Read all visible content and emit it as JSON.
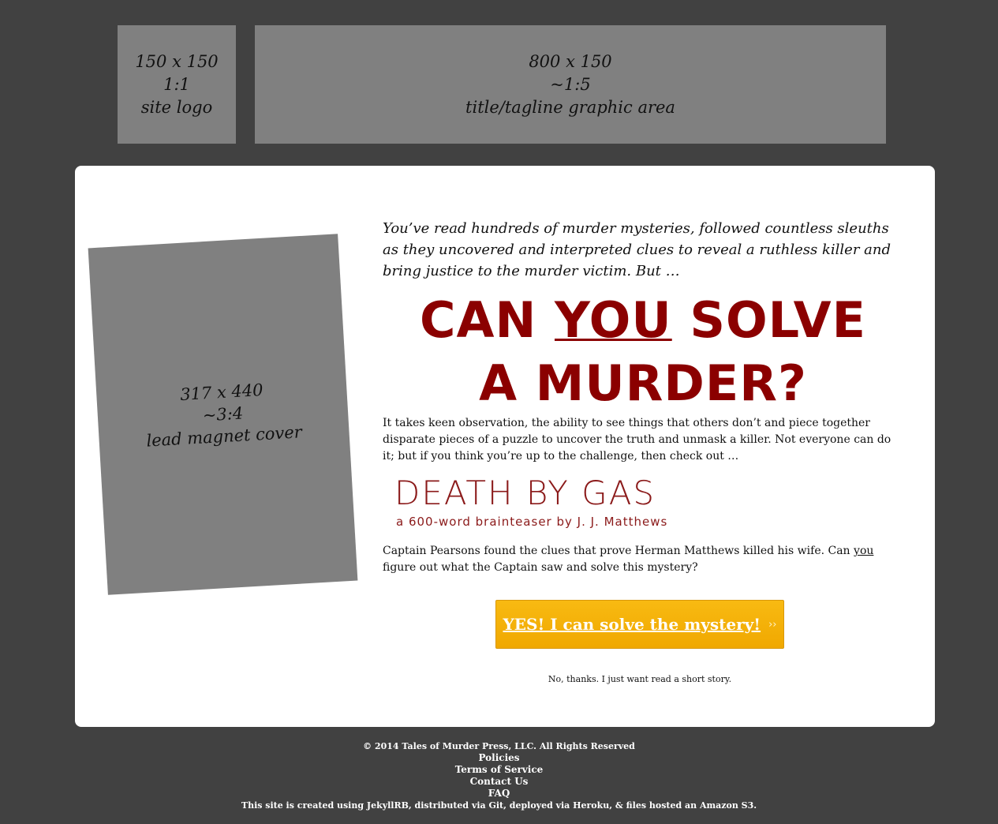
{
  "header": {
    "logo": {
      "size": "150 x 150",
      "ratio": "1:1",
      "label": "site logo"
    },
    "tagline": {
      "size": "800 x 150",
      "ratio": "~1:5",
      "label": "title/tagline graphic area"
    }
  },
  "main": {
    "cover": {
      "size": "317 x 440",
      "ratio": "~3:4",
      "label": "lead magnet cover"
    },
    "intro": "You’ve read hundreds of murder mysteries, followed countless sleuths as they uncovered and interpreted clues to reveal a ruthless killer and bring justice to the murder victim. But …",
    "headline": {
      "line1_start": "CAN ",
      "line1_you": "YOU",
      "line1_end": " SOLVE",
      "line2": "A MURDER?"
    },
    "body": "It takes keen observation, the ability to see things that others don’t and piece together disparate pieces of a puzzle to uncover the truth and unmask a killer. Not everyone can do it; but if you think you’re up to the challenge, then check out …",
    "book": {
      "title": "DEATH BY GAS",
      "byline": "a 600-word brainteaser by J. J. Matthews"
    },
    "teaser": {
      "before": "Captain Pearsons found the clues that prove Herman Matthews killed his wife. Can ",
      "you": "you",
      "after": " figure out what the Captain saw and solve this mystery?"
    },
    "cta": {
      "label": "YES! I can solve the mystery!",
      "arrow": "››"
    },
    "decline": "No, thanks. I just want read a short story."
  },
  "footer": {
    "copyright": "© 2014 Tales of Murder Press, LLC. All Rights Reserved",
    "links": [
      "Policies",
      "Terms of Service",
      "Contact Us",
      "FAQ"
    ],
    "credits": "This site is created using JekyllRB, distributed via Git, deployed via Heroku, & files hosted an Amazon S3."
  },
  "colors": {
    "background": "#414141",
    "placeholder": "#808080",
    "accent": "#8b0000",
    "cta": "#f5b000"
  }
}
